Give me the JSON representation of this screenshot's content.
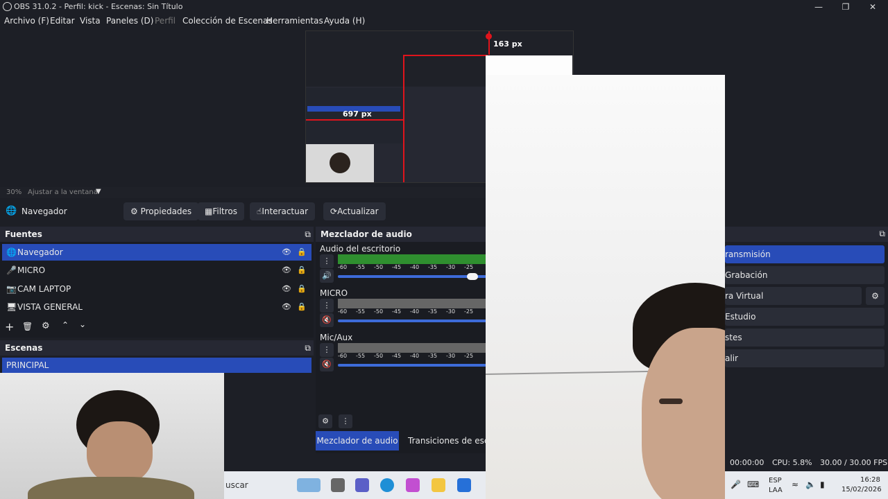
{
  "window": {
    "title": "OBS 31.0.2 - Perfil: kick - Escenas: Sin Título"
  },
  "menu": [
    {
      "label": "Archivo (F)"
    },
    {
      "label": "Editar"
    },
    {
      "label": "Vista"
    },
    {
      "label": "Paneles (D)"
    },
    {
      "label": "Perfil"
    },
    {
      "label": "Colección de Escenas"
    },
    {
      "label": "Herramientas"
    },
    {
      "label": "Ayuda (H)"
    }
  ],
  "preview": {
    "measure_top": "163 px",
    "measure_left": "697 px",
    "zoom_level": "30%",
    "zoom_mode": "Ajustar a la ventana"
  },
  "source_toolbar": {
    "source_name": "Navegador",
    "properties": "Propiedades",
    "filters": "Filtros",
    "interact": "Interactuar",
    "refresh": "Actualizar"
  },
  "sources": {
    "title": "Fuentes",
    "items": [
      {
        "label": "Navegador",
        "icon": "globe-icon",
        "selected": true
      },
      {
        "label": "MICRO",
        "icon": "microphone-icon",
        "selected": false
      },
      {
        "label": "CAM LAPTOP",
        "icon": "camera-icon",
        "selected": false
      },
      {
        "label": "VISTA GENERAL",
        "icon": "monitor-icon",
        "selected": false
      }
    ]
  },
  "scenes": {
    "title": "Escenas",
    "items": [
      {
        "label": "PRINCIPAL",
        "selected": true
      }
    ]
  },
  "mixer": {
    "title": "Mezclador de audio",
    "scale": [
      "-60",
      "-55",
      "-50",
      "-45",
      "-40",
      "-35",
      "-30",
      "-25"
    ],
    "channels": [
      {
        "name": "Audio del escritorio",
        "muted": false,
        "volume": 0.9
      },
      {
        "name": "MICRO",
        "muted": true,
        "volume": 1.0
      },
      {
        "name": "Mic/Aux",
        "muted": true,
        "volume": 1.0
      }
    ],
    "tabs": [
      "Mezclador de audio",
      "Transiciones de escena"
    ]
  },
  "controls": {
    "items": [
      {
        "label": "Iniciar transmisión",
        "visible_text": "ransmisión",
        "active": true
      },
      {
        "label": "Iniciar grabación",
        "visible_text": "Grabación",
        "active": false
      },
      {
        "label": "Iniciar cámara virtual",
        "visible_text": "ra Virtual",
        "active": false
      },
      {
        "label": "Modo estudio",
        "visible_text": "Estudio",
        "active": false
      },
      {
        "label": "Ajustes",
        "visible_text": "stes",
        "active": false
      },
      {
        "label": "Salir",
        "visible_text": "alir",
        "active": false
      }
    ]
  },
  "status": {
    "time": "00:00:00",
    "cpu": "CPU: 5.8%",
    "fps": "30.00 / 30.00 FPS"
  },
  "taskbar": {
    "search_text": "uscar",
    "lang_top": "ESP",
    "lang_bottom": "LAA",
    "clock_time": "16:28",
    "clock_date": "15/02/2026"
  },
  "colors": {
    "accent": "#284cb8",
    "bg": "#1d1f26",
    "red_box": "#e0141c"
  }
}
